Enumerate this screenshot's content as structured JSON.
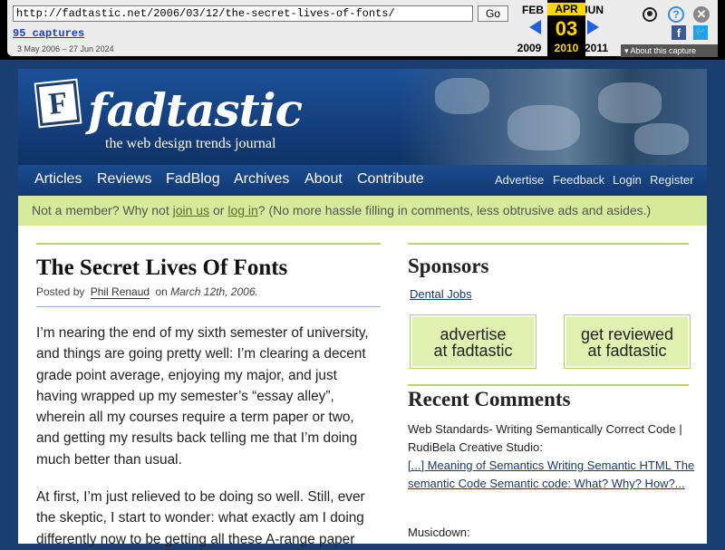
{
  "wayback": {
    "url": "http://fadtastic.net/2006/03/12/the-secret-lives-of-fonts/",
    "go": "Go",
    "captures": "95 captures",
    "range": "3 May 2006 – 27 Jun 2024",
    "prev_month": "FEB",
    "cur_month": "APR",
    "next_month": "JUN",
    "cur_day": "03",
    "prev_year": "2009",
    "cur_year": "2010",
    "next_year": "2011",
    "help_glyph": "?",
    "close_glyph": "✕",
    "fb_glyph": "f",
    "tw_glyph": "🐦",
    "about": "▾ About this capture"
  },
  "header": {
    "logo_letter": "F",
    "logo_text": "fadtastic",
    "tagline": "the web design trends journal"
  },
  "nav": {
    "main": [
      "Articles",
      "Reviews",
      "FadBlog",
      "Archives",
      "About",
      "Contribute"
    ],
    "sub": [
      "Advertise",
      "Feedback",
      "Login",
      "Register"
    ]
  },
  "notice": {
    "pre": "Not a member? Why not ",
    "join": "join us",
    "or": " or ",
    "login": "log in",
    "post": "? (No more hassle filling in comments, less obtrusive ads and asides.)"
  },
  "post": {
    "title": "The Secret Lives Of Fonts",
    "posted_by": "Posted by ",
    "author": "Phil Renaud",
    "on": " on ",
    "date": "March 12th, 2006.",
    "para1": "I’m nearing the end of my sixth semester of university, and things are going pretty well: I’m clearing a decent grade point average, enjoying my major, and just having wrapped up my semester’s “essay alley”, wherein all my courses require a term paper or two, and getting my results back telling me that I’m doing much better than usual.",
    "para2": "At first, I’m just relieved to be doing so well. Still, ever the skeptic, I start to wonder: what exactly am I doing differently now to be getting all these A-range paper"
  },
  "sidebar": {
    "sponsors_heading": "Sponsors",
    "sponsor_link": "Dental Jobs",
    "ad1_line1": "advertise",
    "ad1_line2": "at fadtastic",
    "ad2_line1": "get reviewed",
    "ad2_line2": "at fadtastic",
    "recent_heading": "Recent Comments",
    "rc1_text": "Web Standards- Writing Semantically Correct Code | RudiBela Creative Studio:",
    "rc1_link": "[...] Meaning of Semantics Writing Semantic HTML The semantic Code Semantic code: What? Why? How?...",
    "rc2_text": "Musicdown:"
  },
  "colors": {
    "accent_green": "#bbd36d",
    "header_blue": "#143e7c",
    "wayback_gold": "#ffd700"
  }
}
